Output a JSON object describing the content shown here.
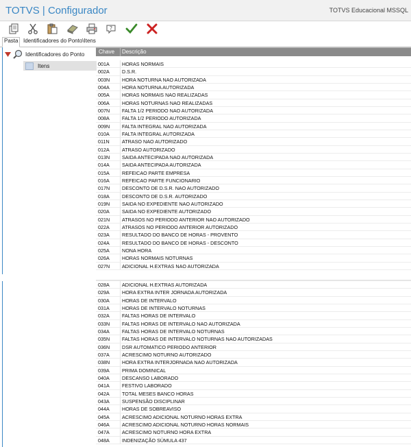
{
  "window": {
    "title": "TOTVS | Configurador",
    "subtitle": "TOTVS Educacional MSSQL"
  },
  "toolbar": {
    "buttons": [
      {
        "name": "copy-button",
        "icon": "copy-icon"
      },
      {
        "name": "cut-button",
        "icon": "scissors-icon"
      },
      {
        "name": "paste-button",
        "icon": "clipboard-icon"
      },
      {
        "name": "eraser-button",
        "icon": "eraser-icon"
      },
      {
        "name": "print-button",
        "icon": "printer-icon"
      },
      {
        "name": "help-button",
        "icon": "help-icon"
      },
      {
        "name": "confirm-button",
        "icon": "checkmark-icon"
      },
      {
        "name": "cancel-button",
        "icon": "close-icon"
      }
    ]
  },
  "tabs": {
    "active": "Pasta",
    "second": "Identificadores do Ponto\\Itens"
  },
  "tree": {
    "root_label": "Identificadores do Ponto",
    "child_label": "Itens"
  },
  "grid": {
    "columns": [
      "Chave",
      "Descrição"
    ],
    "block1": [
      [
        "001A",
        "HORAS NORMAIS"
      ],
      [
        "002A",
        "D.S.R."
      ],
      [
        "003N",
        "HORA NOTURNA NAO AUTORIZADA"
      ],
      [
        "004A",
        "HORA NOTURNA AUTORIZADA"
      ],
      [
        "005A",
        "HORAS NORMAIS NAO REALIZADAS"
      ],
      [
        "006A",
        "HORAS NOTURNAS NAO REALIZADAS"
      ],
      [
        "007N",
        "FALTA 1/2 PERIODO NAO AUTORIZADA"
      ],
      [
        "008A",
        "FALTA 1/2 PERIODO AUTORIZADA"
      ],
      [
        "009N",
        "FALTA INTEGRAL NAO AUTORIZADA"
      ],
      [
        "010A",
        "FALTA INTEGRAL AUTORIZADA"
      ],
      [
        "011N",
        "ATRASO NAO AUTORIZADO"
      ],
      [
        "012A",
        "ATRASO AUTORIZADO"
      ],
      [
        "013N",
        "SAIDA ANTECIPADA NAO AUTORIZADA"
      ],
      [
        "014A",
        "SAIDA ANTECIPADA AUTORIZADA"
      ],
      [
        "015A",
        "REFEICAO PARTE EMPRESA"
      ],
      [
        "016A",
        "REFEICAO PARTE FUNCIONARIO"
      ],
      [
        "017N",
        "DESCONTO DE D.S.R. NAO AUTORIZADO"
      ],
      [
        "018A",
        "DESCONTO DE D.S.R. AUTORIZADO"
      ],
      [
        "019N",
        "SAIDA NO EXPEDIENTE NAO AUTORIZADO"
      ],
      [
        "020A",
        "SAIDA NO EXPEDIENTE AUTORIZADO"
      ],
      [
        "021N",
        "ATRASOS NO PERIODO ANTERIOR NAO AUTORIZADO"
      ],
      [
        "022A",
        "ATRASOS NO PERIODO ANTERIOR AUTORIZADO"
      ],
      [
        "023A",
        "RESULTADO DO BANCO DE HORAS - PROVENTO"
      ],
      [
        "024A",
        "RESULTADO DO BANCO DE HORAS - DESCONTO"
      ],
      [
        "025A",
        "NONA HORA"
      ],
      [
        "026A",
        "HORAS NORMAIS NOTURNAS"
      ],
      [
        "027N",
        "ADICIONAL H.EXTRAS NAO AUTORIZADA"
      ]
    ],
    "block2": [
      [
        "028A",
        "ADICIONAL H.EXTRAS AUTORIZADA"
      ],
      [
        "029A",
        "HORA EXTRA INTER JORNADA AUTORIZADA"
      ],
      [
        "030A",
        "HORAS DE INTERVALO"
      ],
      [
        "031A",
        "HORAS DE INTERVALO NOTURNAS"
      ],
      [
        "032A",
        "FALTAS HORAS DE INTERVALO"
      ],
      [
        "033N",
        "FALTAS HORAS DE INTERVALO NAO AUTORIZADA"
      ],
      [
        "034A",
        "FALTAS HORAS DE INTERVALO NOTURNAS"
      ],
      [
        "035N",
        "FALTAS HORAS DE INTERVALO NOTURNAS NAO AUTORIZADAS"
      ],
      [
        "036N",
        "DSR AUTOMATICO PERIODO ANTERIOR"
      ],
      [
        "037A",
        "ACRESCIMO NOTURNO AUTORIZADO"
      ],
      [
        "038N",
        "HORA EXTRA INTERJORNADA NAO AUTORIZADA"
      ],
      [
        "039A",
        "PRIMA DOMINICAL"
      ],
      [
        "040A",
        "DESCANSO LABORADO"
      ],
      [
        "041A",
        "FESTIVO LABORADO"
      ],
      [
        "042A",
        "TOTAL MESES BANCO HORAS"
      ],
      [
        "043A",
        "SUSPENSÃO DISCIPLINAR"
      ],
      [
        "044A",
        "HORAS DE SOBREAVISO"
      ],
      [
        "045A",
        "ACRESCIMO ADICIONAL NOTURNO HORAS EXTRA"
      ],
      [
        "046A",
        "ACRESCIMO ADICIONAL NOTURNO HORAS NORMAIS"
      ],
      [
        "047A",
        "ACRESCIMO NOTURNO HORA EXTRA"
      ],
      [
        "048A",
        "INDENIZAÇÃO SÚMULA 437"
      ]
    ]
  },
  "colors": {
    "title": "#3a87c4",
    "header": "#8a8a8a",
    "selected": "#e1e1e1"
  }
}
